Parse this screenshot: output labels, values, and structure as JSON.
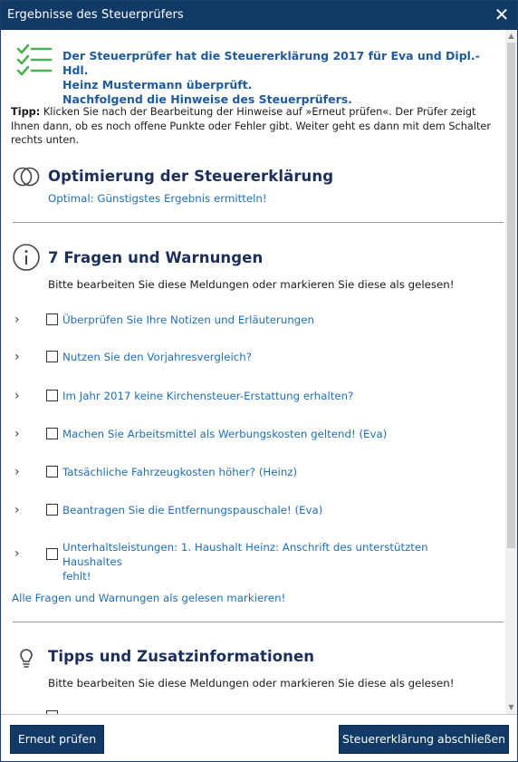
{
  "window": {
    "title": "Ergebnisse des Steuerprüfers",
    "close_glyph": "✕"
  },
  "header": {
    "line1": "Der Steuerprüfer hat die Steuererklärung 2017 für Eva und Dipl.-Hdl.",
    "line2": "Heinz Mustermann überprüft.",
    "line3": "Nachfolgend die Hinweise des Steuerprüfers.",
    "icon": "checklist-icon"
  },
  "tipp": {
    "label": "Tipp:",
    "text": " Klicken Sie nach der Bearbeitung der Hinweise auf »Erneut prüfen«. Der Prüfer zeigt Ihnen dann, ob es noch offene Punkte oder Fehler gibt. Weiter geht es dann mit dem Schalter rechts unten."
  },
  "optimierung": {
    "icon": "rings-icon",
    "title": "Optimierung der Steuererklärung",
    "link": "Optimal: Günstigstes Ergebnis ermitteln!"
  },
  "fragen": {
    "icon": "info-icon",
    "title": "7 Fragen und Warnungen",
    "subtitle": "Bitte bearbeiten Sie diese Meldungen oder markieren Sie diese als gelesen!",
    "items": [
      {
        "label": "Überprüfen Sie Ihre Notizen und Erläuterungen",
        "checked": false
      },
      {
        "label": "Nutzen Sie den Vorjahresvergleich?",
        "checked": false
      },
      {
        "label": "Im Jahr 2017 keine Kirchensteuer-Erstattung erhalten?",
        "checked": false
      },
      {
        "label": "Machen Sie Arbeitsmittel als Werbungskosten geltend! (Eva)",
        "checked": false
      },
      {
        "label": "Tatsächliche Fahrzeugkosten höher? (Heinz)",
        "checked": false
      },
      {
        "label": "Beantragen Sie die Entfernungspauschale! (Eva)",
        "checked": false
      },
      {
        "label": "Unterhaltsleistungen: 1. Haushalt Heinz: Anschrift des unterstützten Haushaltes",
        "label2": "fehlt!",
        "checked": false
      }
    ],
    "mark_all": "Alle Fragen und Warnungen als gelesen markieren!"
  },
  "tipps": {
    "icon": "lightbulb-icon",
    "title": "Tipps und Zusatzinformationen",
    "subtitle": "Bitte bearbeiten Sie diese Meldungen oder markieren Sie diese als gelesen!"
  },
  "footer": {
    "recheck_button": "Erneut prüfen",
    "finish_button": "Steuererklärung abschließen"
  },
  "colors": {
    "titlebar": "#123a66",
    "link": "#1f6fb5",
    "header_text": "#1f5a99",
    "check_icon": "#4caf50",
    "section_title": "#1b2f5a"
  }
}
